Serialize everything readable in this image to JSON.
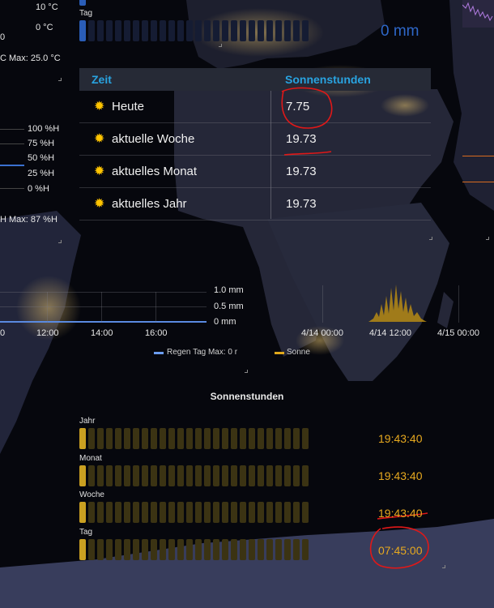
{
  "top_left": {
    "temp_ticks": [
      "10 °C",
      "0 °C"
    ],
    "temp_minmax": "C  Max: 25.0 °C",
    "hum_ticks": [
      "100 %H",
      "75 %H",
      "50 %H",
      "25 %H",
      "0 %H"
    ],
    "hum_minmax": "H  Max: 87 %H",
    "edge_zero": "0"
  },
  "rain_today": {
    "label": "Tag",
    "value": "0 mm",
    "segments_on": 1,
    "segments_total": 26
  },
  "sun_table": {
    "col_zeit": "Zeit",
    "col_sonnenstunden": "Sonnenstunden",
    "sun_icon": "sun-icon",
    "rows": [
      {
        "name": "Heute",
        "value": "7.75"
      },
      {
        "name": "aktuelle Woche",
        "value": "19.73"
      },
      {
        "name": "aktuelles Monat",
        "value": "19.73"
      },
      {
        "name": "aktuelles Jahr",
        "value": "19.73"
      }
    ]
  },
  "rain_chart": {
    "y_ticks": [
      "1.0 mm",
      "0.5 mm",
      "0 mm"
    ],
    "x_ticks": [
      "0",
      "12:00",
      "14:00",
      "16:00"
    ],
    "legend": "Regen Tag  Max: 0 r",
    "legend_color": "#6b9cf0"
  },
  "sun_chart": {
    "x_ticks": [
      "4/14 00:00",
      "4/14 12:00",
      "4/15 00:00"
    ],
    "legend": "Sonne",
    "legend_color": "#e0a81c"
  },
  "sun_section": {
    "title": "Sonnenstunden",
    "rows": [
      {
        "label": "Jahr",
        "time": "19:43:40",
        "segments_on": 1
      },
      {
        "label": "Monat",
        "time": "19:43:40",
        "segments_on": 1
      },
      {
        "label": "Woche",
        "time": "19:43:40",
        "segments_on": 1
      },
      {
        "label": "Tag",
        "time": "07:45:00",
        "segments_on": 1
      }
    ],
    "segments_total": 26
  },
  "colors": {
    "accent_blue": "#29a3e0",
    "sun_yellow": "#ffc400",
    "time_orange": "#e6a81f",
    "annotation_red": "#e01818"
  }
}
